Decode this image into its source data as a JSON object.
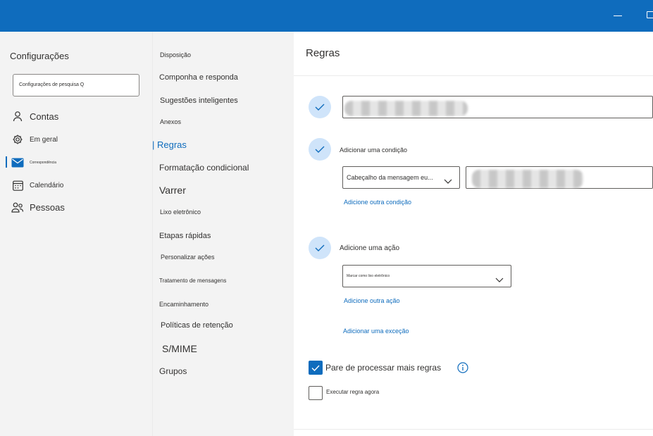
{
  "colors": {
    "accent": "#0f6cbd",
    "step_bg": "#cfe4fa",
    "topbar": "#0f6cbd"
  },
  "window": {
    "minimize_icon": "minimize-icon",
    "maximize_icon": "maximize-icon"
  },
  "leftnav": {
    "title": "Configurações",
    "search_placeholder": "Configurações de pesquisa Q",
    "items": [
      {
        "label": "Contas",
        "icon": "person-icon"
      },
      {
        "label": "Em geral",
        "icon": "gear-icon"
      },
      {
        "label": "Correspondência",
        "icon": "mail-icon",
        "selected": true
      },
      {
        "label": "Calendário",
        "icon": "calendar-icon"
      },
      {
        "label": "Pessoas",
        "icon": "people-icon"
      }
    ]
  },
  "midnav": {
    "items": [
      "Disposição",
      "Componha e responda",
      "Sugestões inteligentes",
      "Anexos",
      "| Regras",
      "Formatação condicional",
      "Varrer",
      "Lixo eletrônico",
      "Etapas rápidas",
      "Personalizar ações",
      "Tratamento de mensagens",
      "Encaminhamento",
      "Políticas de retenção",
      "S/MIME",
      "Grupos"
    ]
  },
  "main": {
    "title": "Regras",
    "add_condition_label": "Adicionar uma condição",
    "condition_dropdown": "Cabeçalho da mensagem eu...",
    "add_another_condition": "Adicione outra condição",
    "add_action_label": "Adicione uma ação",
    "action_dropdown": "Marcar como lixo eletrônico",
    "add_another_action": "Adicione outra ação",
    "add_exception": "Adicionar uma exceção",
    "stop_processing_label": "Pare de processar mais regras",
    "stop_processing_checked": true,
    "run_now_label": "Executar regra agora",
    "run_now_checked": false
  }
}
